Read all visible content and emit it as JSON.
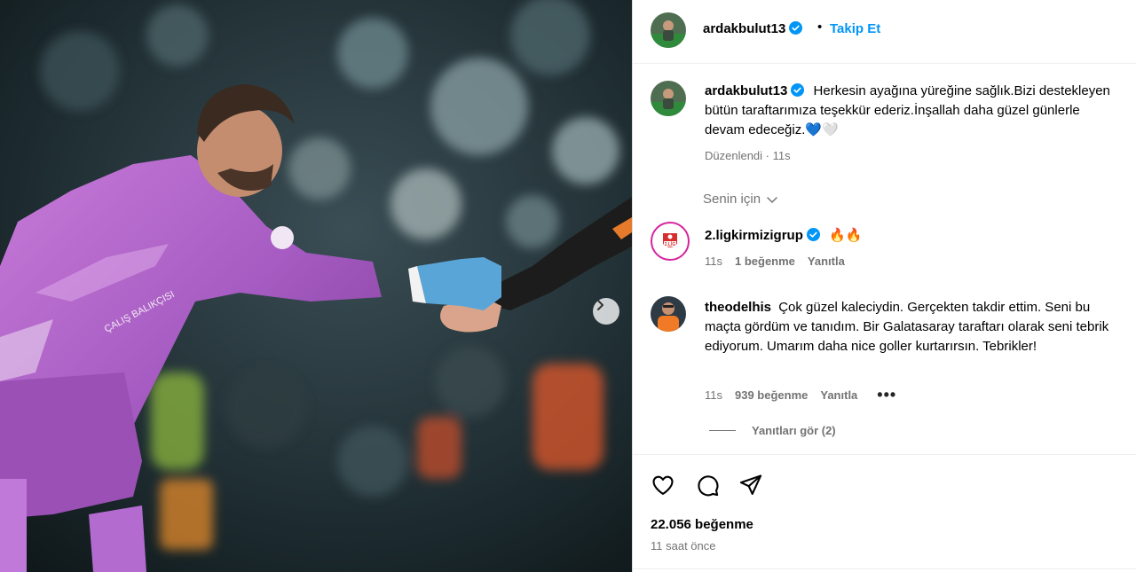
{
  "post": {
    "username": "ardakbulut13",
    "dot": "•",
    "follow_label": "Takip Et",
    "caption": "Herkesin ayağına yüreğine sağlık.Bizi destekleyen bütün taraftarımıza teşekkür ederiz.İnşallah daha güzel günlerle devam edeceğiz.💙🤍",
    "edited_label": "Düzenlendi",
    "edited_dot": "·",
    "edited_time": "11s"
  },
  "comments": {
    "filter_label": "Senin için",
    "items": [
      {
        "username": "2.ligkirmizigrup",
        "text": "🔥🔥",
        "time": "11s",
        "likes": "1 beğenme",
        "reply": "Yanıtla",
        "avatar_text": "2.LİG"
      },
      {
        "username": "theodelhis",
        "text": "Çok güzel kaleciydin. Gerçekten takdir ettim. Seni bu maçta gördüm ve tanıdım. Bir Galatasaray taraftarı olarak seni tebrik ediyorum. Umarım daha nice goller kurtarırsın. Tebrikler!",
        "time": "11s",
        "likes": "939 beğenme",
        "reply": "Yanıtla",
        "more": "•••"
      }
    ],
    "view_replies": "Yanıtları gör (2)"
  },
  "footer": {
    "likes_count": "22.056 beğenme",
    "time": "11 saat önce"
  },
  "icons": {
    "verified": "verified-badge-icon",
    "like": "heart-icon",
    "comment": "comment-icon",
    "share": "send-icon",
    "next": "chevron-right-icon",
    "dropdown": "chevron-down-icon"
  },
  "colors": {
    "accent": "#0095f6",
    "secondary_text": "#737373",
    "verified": "#0095f6",
    "keeper_kit": "#b05cc9"
  }
}
